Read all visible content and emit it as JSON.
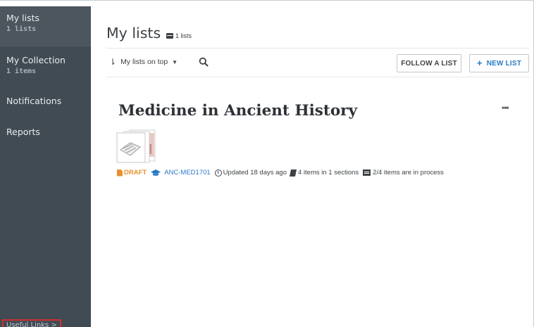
{
  "sidebar": {
    "my_lists": {
      "title": "My lists",
      "sub": "1 lists"
    },
    "my_collection": {
      "title": "My Collection",
      "sub": "1 items"
    },
    "notifications": {
      "title": "Notifications"
    },
    "reports": {
      "title": "Reports"
    },
    "useful_links": "Useful Links >"
  },
  "header": {
    "title": "My lists",
    "count": "1 lists"
  },
  "toolbar": {
    "sort_label": "My lists on top",
    "follow_label": "FOLLOW A LIST",
    "new_label": "NEW LIST"
  },
  "list": {
    "title": "Medicine in Ancient History",
    "more": "•••",
    "status": "DRAFT",
    "course": "ANC-MED1701",
    "updated": "Updated 18 days ago",
    "items": "4 items in 1 sections",
    "in_process": "2/4 items are in process"
  },
  "colors": {
    "sidebar_bg": "#414b54",
    "sidebar_active": "#4d565f",
    "accent_blue": "#2a78c4",
    "draft_orange": "#e8902d",
    "highlight_red": "#d32f2f"
  },
  "icons": {
    "sort": "sort-icon",
    "search": "search-icon",
    "plus": "plus-icon",
    "draft": "document-icon",
    "course": "graduation-cap-icon",
    "updated": "clock-icon",
    "items": "book-icon",
    "in_process": "list-status-icon"
  }
}
